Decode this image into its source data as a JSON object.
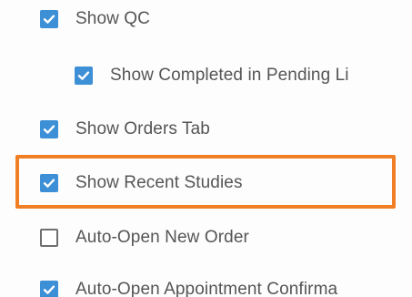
{
  "settings": {
    "items": [
      {
        "label": "Show QC",
        "checked": true
      },
      {
        "label": "Show Completed in Pending Li",
        "checked": true
      },
      {
        "label": "Show Orders Tab",
        "checked": true
      },
      {
        "label": "Show Recent Studies",
        "checked": true
      },
      {
        "label": "Auto-Open New Order",
        "checked": false
      },
      {
        "label": "Auto-Open Appointment Confirma",
        "checked": true
      }
    ]
  },
  "colors": {
    "checkbox_checked": "#3d8fd6",
    "highlight": "#f07f25",
    "text": "#555555"
  },
  "icons": {
    "checkmark": "checkmark-icon"
  }
}
